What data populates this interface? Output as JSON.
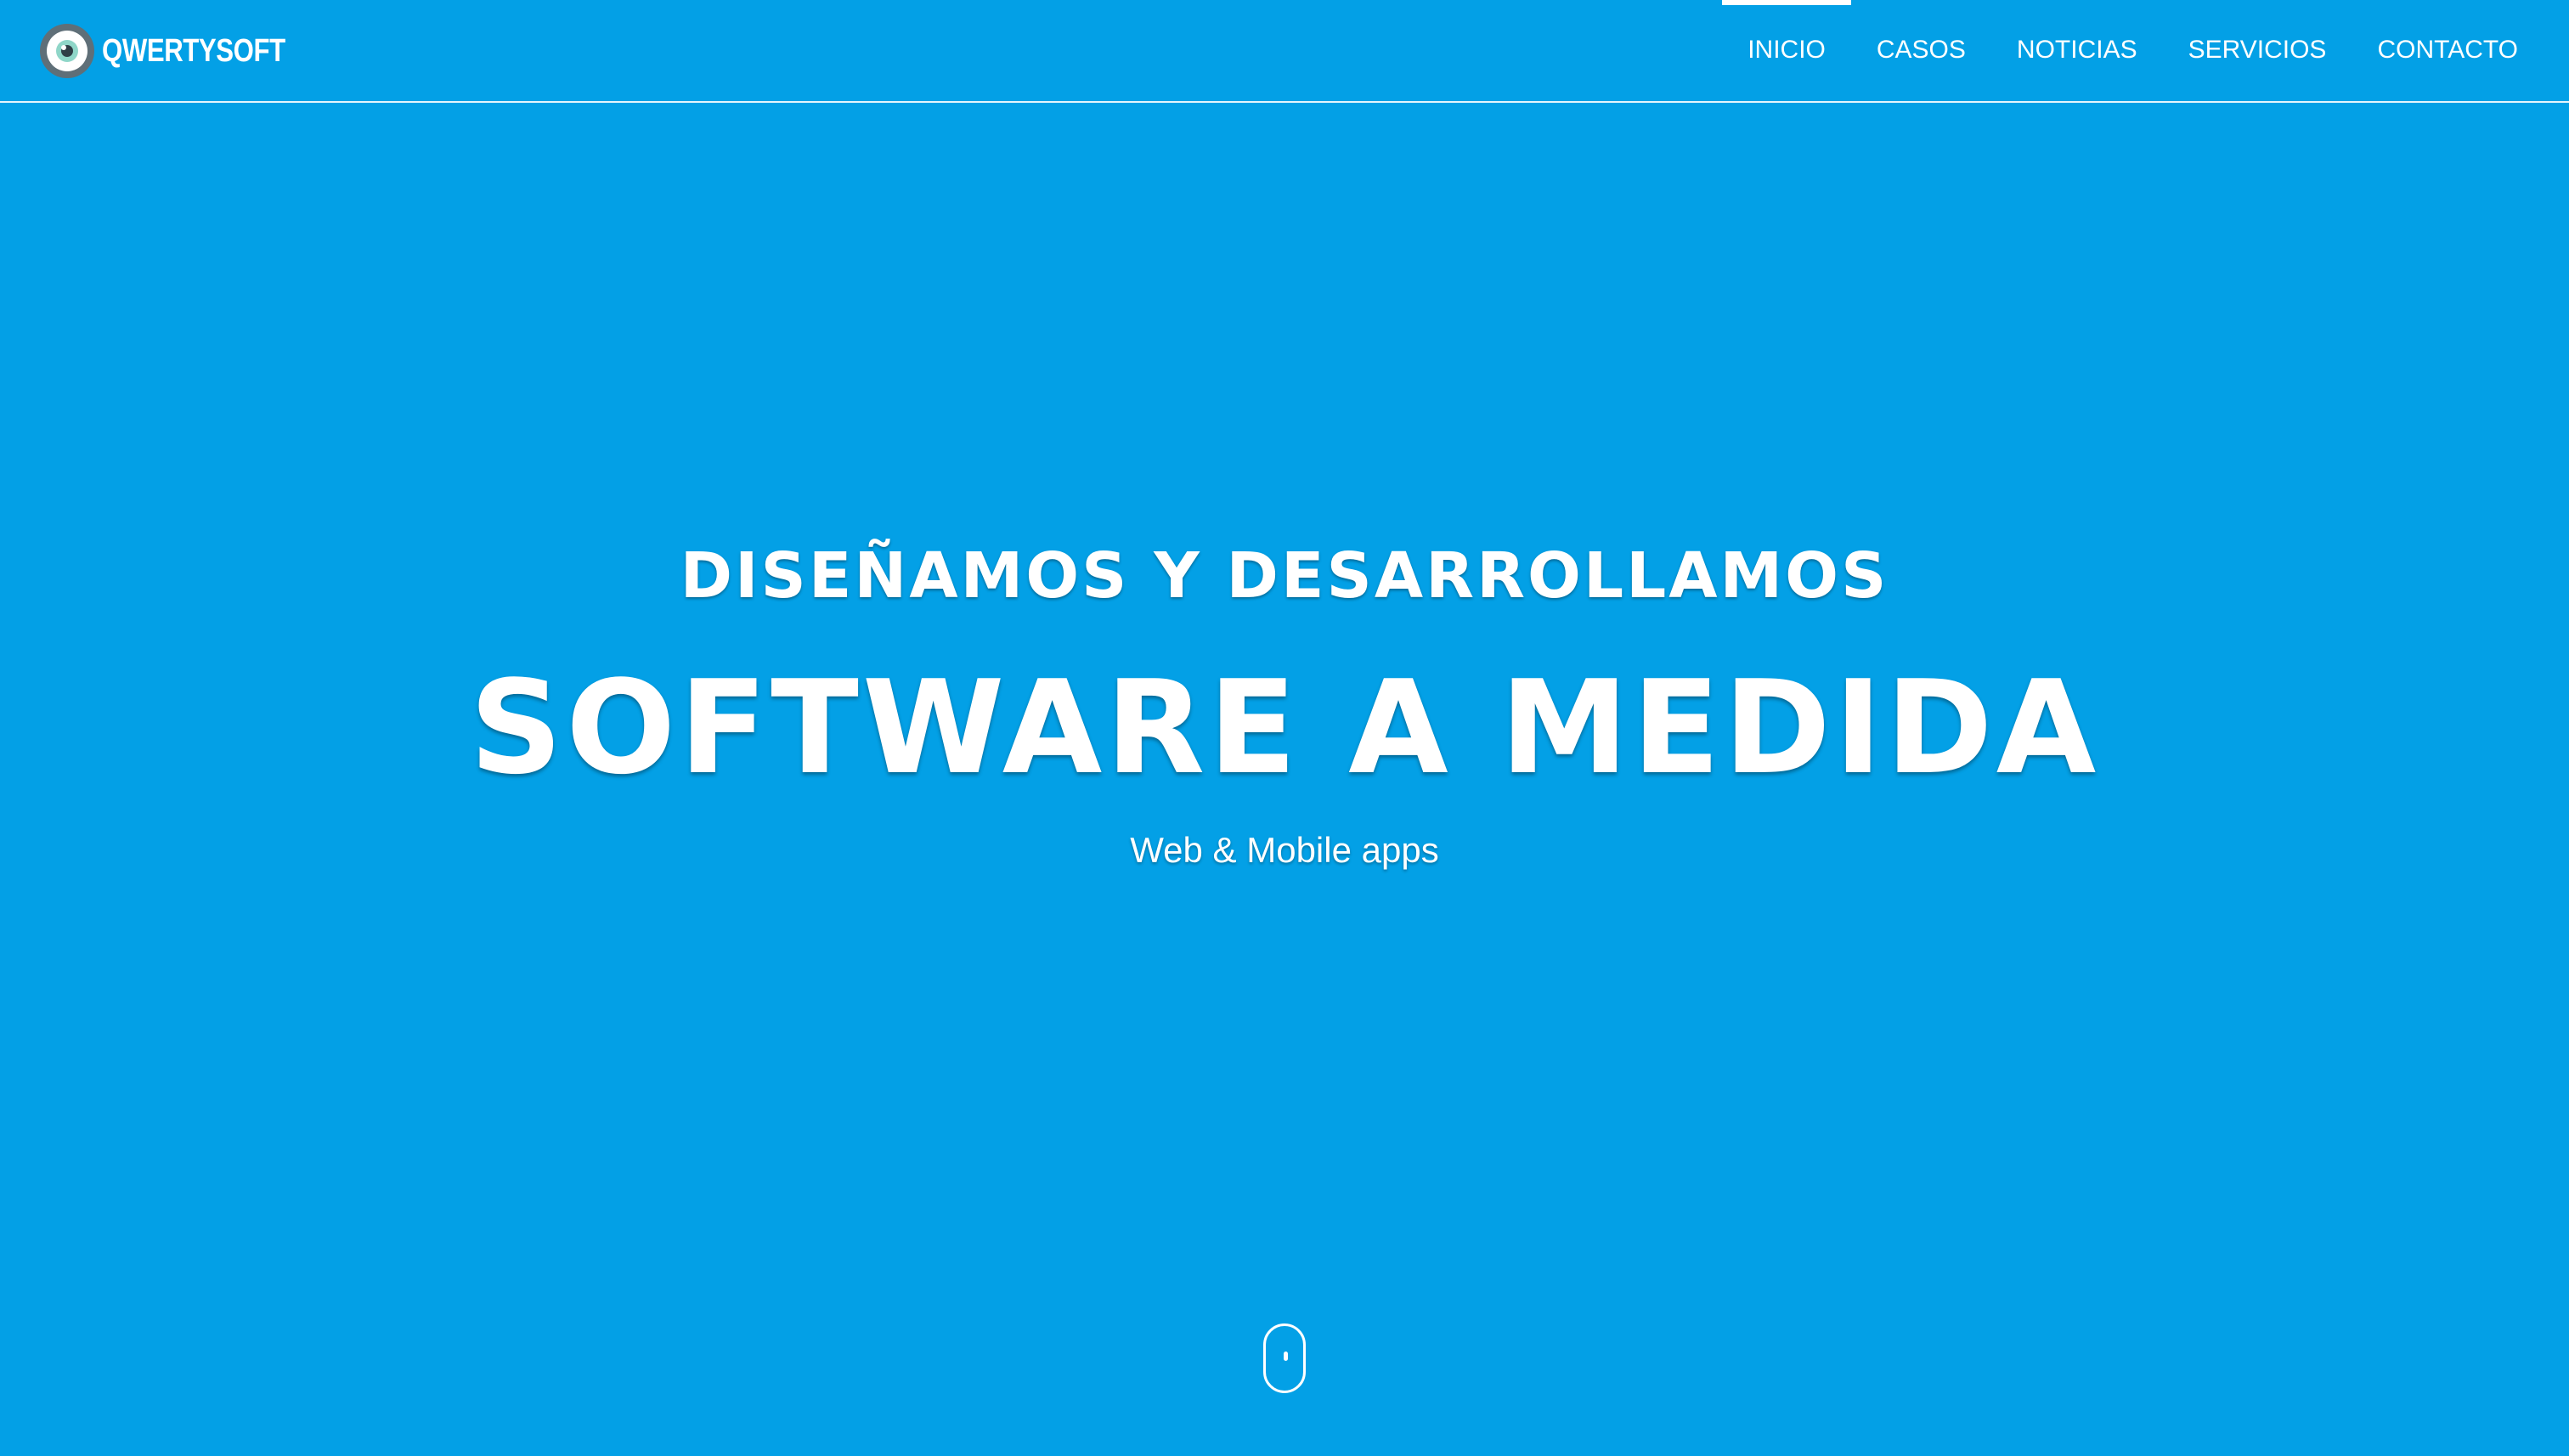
{
  "colors": {
    "background": "#03a0e6",
    "text": "#ffffff",
    "logo_ring": "#5f6f78",
    "logo_iris": "#8fd6c8"
  },
  "header": {
    "brand_name": "QWERTYSOFT",
    "logo_icon": "eye-logo-icon"
  },
  "nav": {
    "items": [
      {
        "label": "INICIO",
        "active": true
      },
      {
        "label": "CASOS",
        "active": false
      },
      {
        "label": "NOTICIAS",
        "active": false
      },
      {
        "label": "SERVICIOS",
        "active": false
      },
      {
        "label": "CONTACTO",
        "active": false
      }
    ]
  },
  "hero": {
    "kicker": "DISEÑAMOS Y DESARROLLAMOS",
    "title": "SOFTWARE A MEDIDA",
    "subtitle": "Web & Mobile apps",
    "scroll_icon": "mouse-scroll-icon"
  }
}
